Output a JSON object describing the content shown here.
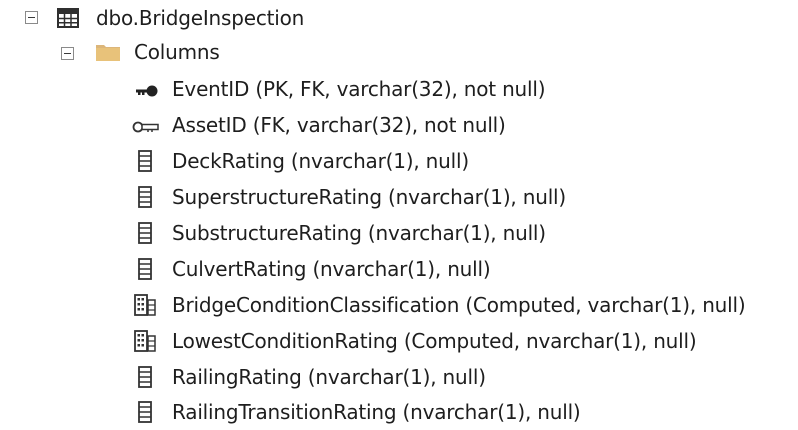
{
  "tree": {
    "table": {
      "name": "dbo.BridgeInspection",
      "icon": "table-icon",
      "expanded": true
    },
    "folder": {
      "name": "Columns",
      "icon": "folder-icon",
      "expanded": true
    },
    "columns": [
      {
        "label": "EventID (PK, FK, varchar(32), not null)",
        "icon": "primary-key-icon"
      },
      {
        "label": "AssetID (FK, varchar(32), not null)",
        "icon": "foreign-key-icon"
      },
      {
        "label": "DeckRating (nvarchar(1), null)",
        "icon": "column-icon"
      },
      {
        "label": "SuperstructureRating (nvarchar(1), null)",
        "icon": "column-icon"
      },
      {
        "label": "SubstructureRating (nvarchar(1), null)",
        "icon": "column-icon"
      },
      {
        "label": "CulvertRating (nvarchar(1), null)",
        "icon": "column-icon"
      },
      {
        "label": "BridgeConditionClassification (Computed, varchar(1), null)",
        "icon": "computed-column-icon"
      },
      {
        "label": "LowestConditionRating (Computed, nvarchar(1), null)",
        "icon": "computed-column-icon"
      },
      {
        "label": "RailingRating (nvarchar(1), null)",
        "icon": "column-icon"
      },
      {
        "label": "RailingTransitionRating (nvarchar(1), null)",
        "icon": "column-icon"
      }
    ]
  }
}
